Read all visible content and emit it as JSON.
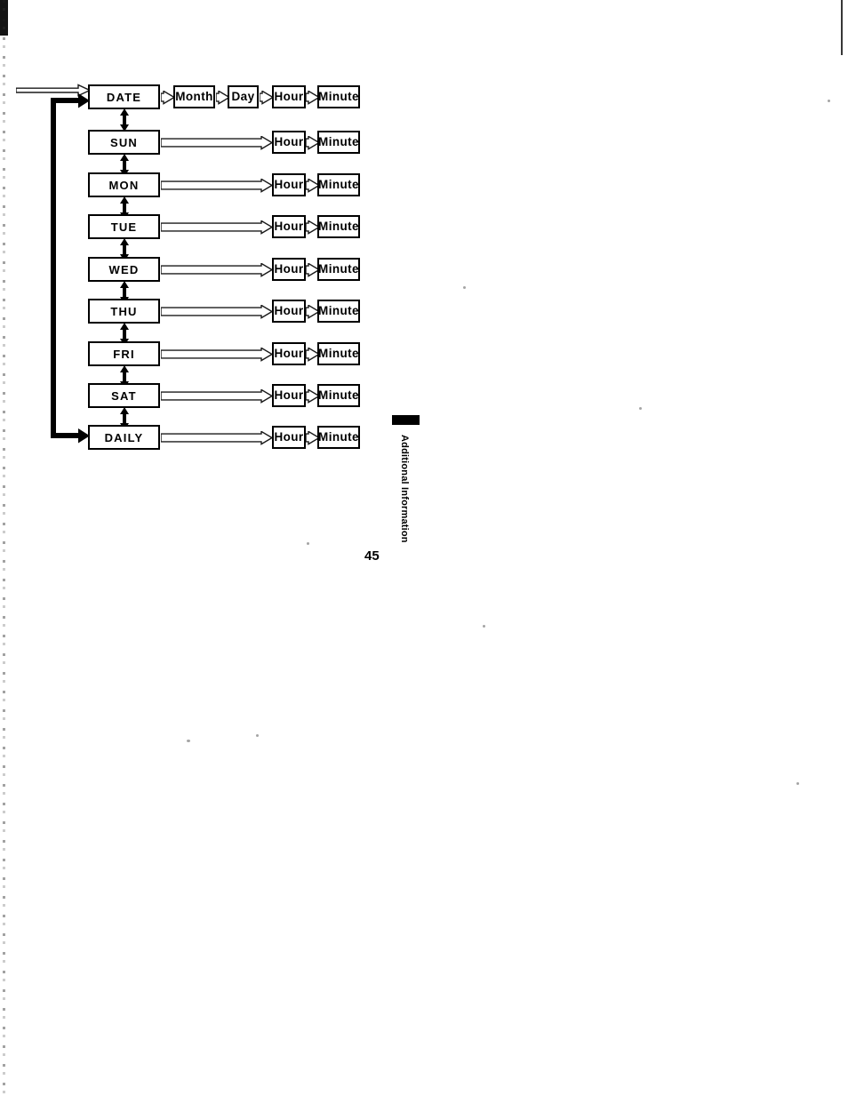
{
  "page": {
    "number": "45",
    "margin_tab_label": "Additional Information",
    "ink_color": "#000000",
    "background_color": "#ffffff"
  },
  "diagram": {
    "name": "timer-setting-flow",
    "entry_arrow": "entry-arrow",
    "loop_arrow": "feedback-loop-arrow",
    "rows": [
      {
        "mode": "DATE",
        "fields": [
          "Month",
          "Day",
          "Hour",
          "Minute"
        ]
      },
      {
        "mode": "SUN",
        "fields": [
          "Hour",
          "Minute"
        ]
      },
      {
        "mode": "MON",
        "fields": [
          "Hour",
          "Minute"
        ]
      },
      {
        "mode": "TUE",
        "fields": [
          "Hour",
          "Minute"
        ]
      },
      {
        "mode": "WED",
        "fields": [
          "Hour",
          "Minute"
        ]
      },
      {
        "mode": "THU",
        "fields": [
          "Hour",
          "Minute"
        ]
      },
      {
        "mode": "FRI",
        "fields": [
          "Hour",
          "Minute"
        ]
      },
      {
        "mode": "SAT",
        "fields": [
          "Hour",
          "Minute"
        ]
      },
      {
        "mode": "DAILY",
        "fields": [
          "Hour",
          "Minute"
        ]
      }
    ]
  }
}
